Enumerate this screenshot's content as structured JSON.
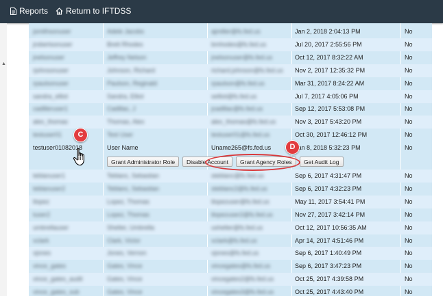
{
  "topbar": {
    "reports_label": "Reports",
    "return_label": "Return to IFTDSS",
    "icons": {
      "reports": "document-icon",
      "return": "home-icon"
    }
  },
  "rows_before": [
    {
      "user": "jsmithsonuser",
      "name": "Adele Jacobs",
      "email": "ajmiller@fs.fed.us",
      "date": "Jan 2, 2018 2:04:13 PM",
      "flag": "No"
    },
    {
      "user": "jrobertsonuser",
      "name": "Brett Rhodes",
      "email": "bmhodes@fs.fed.us",
      "date": "Jul 20, 2017 2:55:56 PM",
      "flag": "No"
    },
    {
      "user": "jnelsonuser",
      "name": "Jeffrey Nelson",
      "email": "jnelsonuser@fs.fed.us",
      "date": "Oct 12, 2017 8:32:22 AM",
      "flag": "No"
    },
    {
      "user": "rjohnsonuser",
      "name": "Johnson, Richard",
      "email": "richard.johnson@fs.fed.us",
      "date": "Nov 2, 2017 12:35:32 PM",
      "flag": "No"
    },
    {
      "user": "rpaulsonuser",
      "name": "Paulson, Reginald",
      "email": "rpaulson@fs.fed.us",
      "date": "Mar 31, 2017 8:24:22 AM",
      "flag": "No"
    },
    {
      "user": "sandra_elliot",
      "name": "Sandra, Elliot",
      "email": "selliot@fs.fed.us",
      "date": "Jul 7, 2017 4:05:06 PM",
      "flag": "No"
    },
    {
      "user": "cadilleruser1",
      "name": "Cadillac, J",
      "email": "jcadillac@fs.fed.us",
      "date": "Sep 12, 2017 5:53:08 PM",
      "flag": "No"
    },
    {
      "user": "alex_thomas",
      "name": "Thomas, Alex",
      "email": "alex_thomas@fs.fed.us",
      "date": "Nov 3, 2017 5:43:20 PM",
      "flag": "No"
    },
    {
      "user": "testuser01",
      "name": "Test User",
      "email": "testuser01@fs.fed.us",
      "date": "Oct 30, 2017 12:46:12 PM",
      "flag": "No"
    }
  ],
  "selected_row": {
    "user": "testuser01082018",
    "name": "User Name",
    "email": "Uname265@fs.fed.us",
    "date": "Jan 8, 2018 5:32:23 PM",
    "flag": "No"
  },
  "actions": {
    "grant_admin": "Grant Administrator Role",
    "disable": "Disable Account",
    "grant_agency": "Grant Agency Roles",
    "audit": "Get Audit Log"
  },
  "rows_after": [
    {
      "user": "teblanuser1",
      "name": "Teblanc, Sebastian",
      "email": "steblanc@fs.fed.us",
      "date": "Sep 6, 2017 4:31:47 PM",
      "flag": "No"
    },
    {
      "user": "teblanuser2",
      "name": "Teblanc, Sebastian",
      "email": "steblanc2@fs.fed.us",
      "date": "Sep 6, 2017 4:32:23 PM",
      "flag": "No"
    },
    {
      "user": "tlopez",
      "name": "Lopez, Thomas",
      "email": "tlopezuser@fs.fed.us",
      "date": "May 11, 2017 3:54:41 PM",
      "flag": "No"
    },
    {
      "user": "tuser2",
      "name": "Lopez, Thomas",
      "email": "tlopezuser2@fs.fed.us",
      "date": "Nov 27, 2017 3:42:14 PM",
      "flag": "No"
    },
    {
      "user": "umbrellauser",
      "name": "Shelter, Umbrella",
      "email": "ushelter@fs.fed.us",
      "date": "Oct 12, 2017 10:56:35 AM",
      "flag": "No"
    },
    {
      "user": "vclark",
      "name": "Clark, Victor",
      "email": "vclark@fs.fed.us",
      "date": "Apr 14, 2017 4:51:46 PM",
      "flag": "No"
    },
    {
      "user": "vjones",
      "name": "Jones, Vernon",
      "email": "vjones@fs.fed.us",
      "date": "Sep 6, 2017 1:40:49 PM",
      "flag": "No"
    },
    {
      "user": "vince_gates",
      "name": "Gates, Vince",
      "email": "vincegates@fs.fed.us",
      "date": "Sep 6, 2017 3:47:23 PM",
      "flag": "No"
    },
    {
      "user": "vince_gates_audit",
      "name": "Gates, Vince",
      "email": "vincegates2@fs.fed.us",
      "date": "Oct 25, 2017 4:39:58 PM",
      "flag": "No"
    },
    {
      "user": "vince_gates_sub",
      "name": "Gates, Vince",
      "email": "vincegates3@fs.fed.us",
      "date": "Oct 25, 2017 4:43:40 PM",
      "flag": "No"
    }
  ],
  "callouts": {
    "c": "C",
    "d": "D"
  },
  "colors": {
    "topbar": "#2b3a47",
    "panel": "#d2e8f5",
    "callout": "#e23c3f"
  }
}
